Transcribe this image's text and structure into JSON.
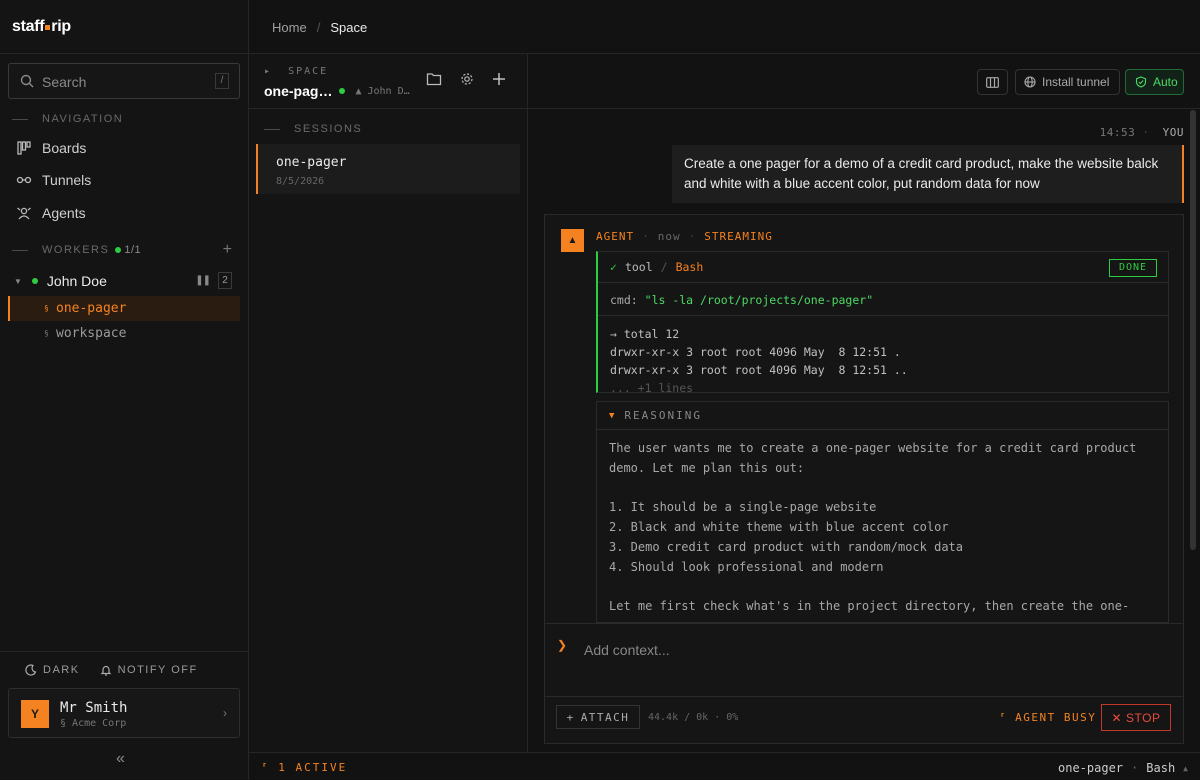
{
  "app": {
    "logo_left": "staff",
    "logo_right": "rip",
    "accent_color": "#f58220",
    "success_color": "#2ecc40",
    "danger_color": "#e74c3c"
  },
  "breadcrumb": {
    "home": "Home",
    "separator": "/",
    "current": "Space"
  },
  "sidebar": {
    "search": {
      "placeholder": "Search",
      "shortcut": "/"
    },
    "navigation_label": "NAVIGATION",
    "nav_items": [
      {
        "label": "Boards",
        "icon": "boards-icon"
      },
      {
        "label": "Tunnels",
        "icon": "tunnel-icon"
      },
      {
        "label": "Agents",
        "icon": "agents-icon"
      }
    ],
    "workers_label": "WORKERS",
    "workers_count": "1/1",
    "worker": {
      "name": "John Doe",
      "session_count": "2"
    },
    "worker_sessions": [
      {
        "label": "one-pager",
        "active": true
      },
      {
        "label": "workspace",
        "active": false
      }
    ],
    "theme_toggle": "DARK",
    "notify_toggle": "NOTIFY OFF",
    "user": {
      "initial": "Y",
      "name": "Mr Smith",
      "org": "Acme Corp"
    }
  },
  "space": {
    "label": "SPACE",
    "title": "one-pag…",
    "owner": "John D…",
    "sessions_label": "SESSIONS",
    "sessions": [
      {
        "name": "one-pager",
        "date": "8/5/2026"
      }
    ]
  },
  "toolbar": {
    "tunnel_label": "Install tunnel",
    "auto_label": "Auto"
  },
  "chat": {
    "user_message": {
      "time": "14:53",
      "sender": "YOU",
      "text": "Create a one pager for a demo of a credit card product, make the website balck and white with a blue accent color, put random data for now"
    },
    "agent": {
      "avatar": "▲",
      "name": "AGENT",
      "time": "now",
      "status": "STREAMING",
      "tool": {
        "check": "✓",
        "kind": "tool",
        "name": "Bash",
        "status": "DONE",
        "cmd_prefix": "cmd:",
        "cmd": "\"ls -la /root/projects/one-pager\"",
        "output_lines": [
          "→ total 12",
          "drwxr-xr-x 3 root root 4096 May  8 12:51 .",
          "drwxr-xr-x 3 root root 4096 May  8 12:51 .."
        ],
        "more": "... +1 lines"
      },
      "reasoning": {
        "label": "REASONING",
        "text": "The user wants me to create a one-pager website for a credit card product demo. Let me plan this out:\n\n1. It should be a single-page website\n2. Black and white theme with blue accent color\n3. Demo credit card product with random/mock data\n4. Should look professional and modern\n\nLet me first check what's in the project directory, then create the one-"
      }
    }
  },
  "composer": {
    "placeholder": "Add context...",
    "attach_label": "ATTACH",
    "tokens": "44.4k / 0k · 0%",
    "busy_label": "AGENT BUSY",
    "stop_label": "STOP"
  },
  "footer": {
    "active": "1 ACTIVE",
    "session": "one-pager",
    "tool": "Bash"
  }
}
